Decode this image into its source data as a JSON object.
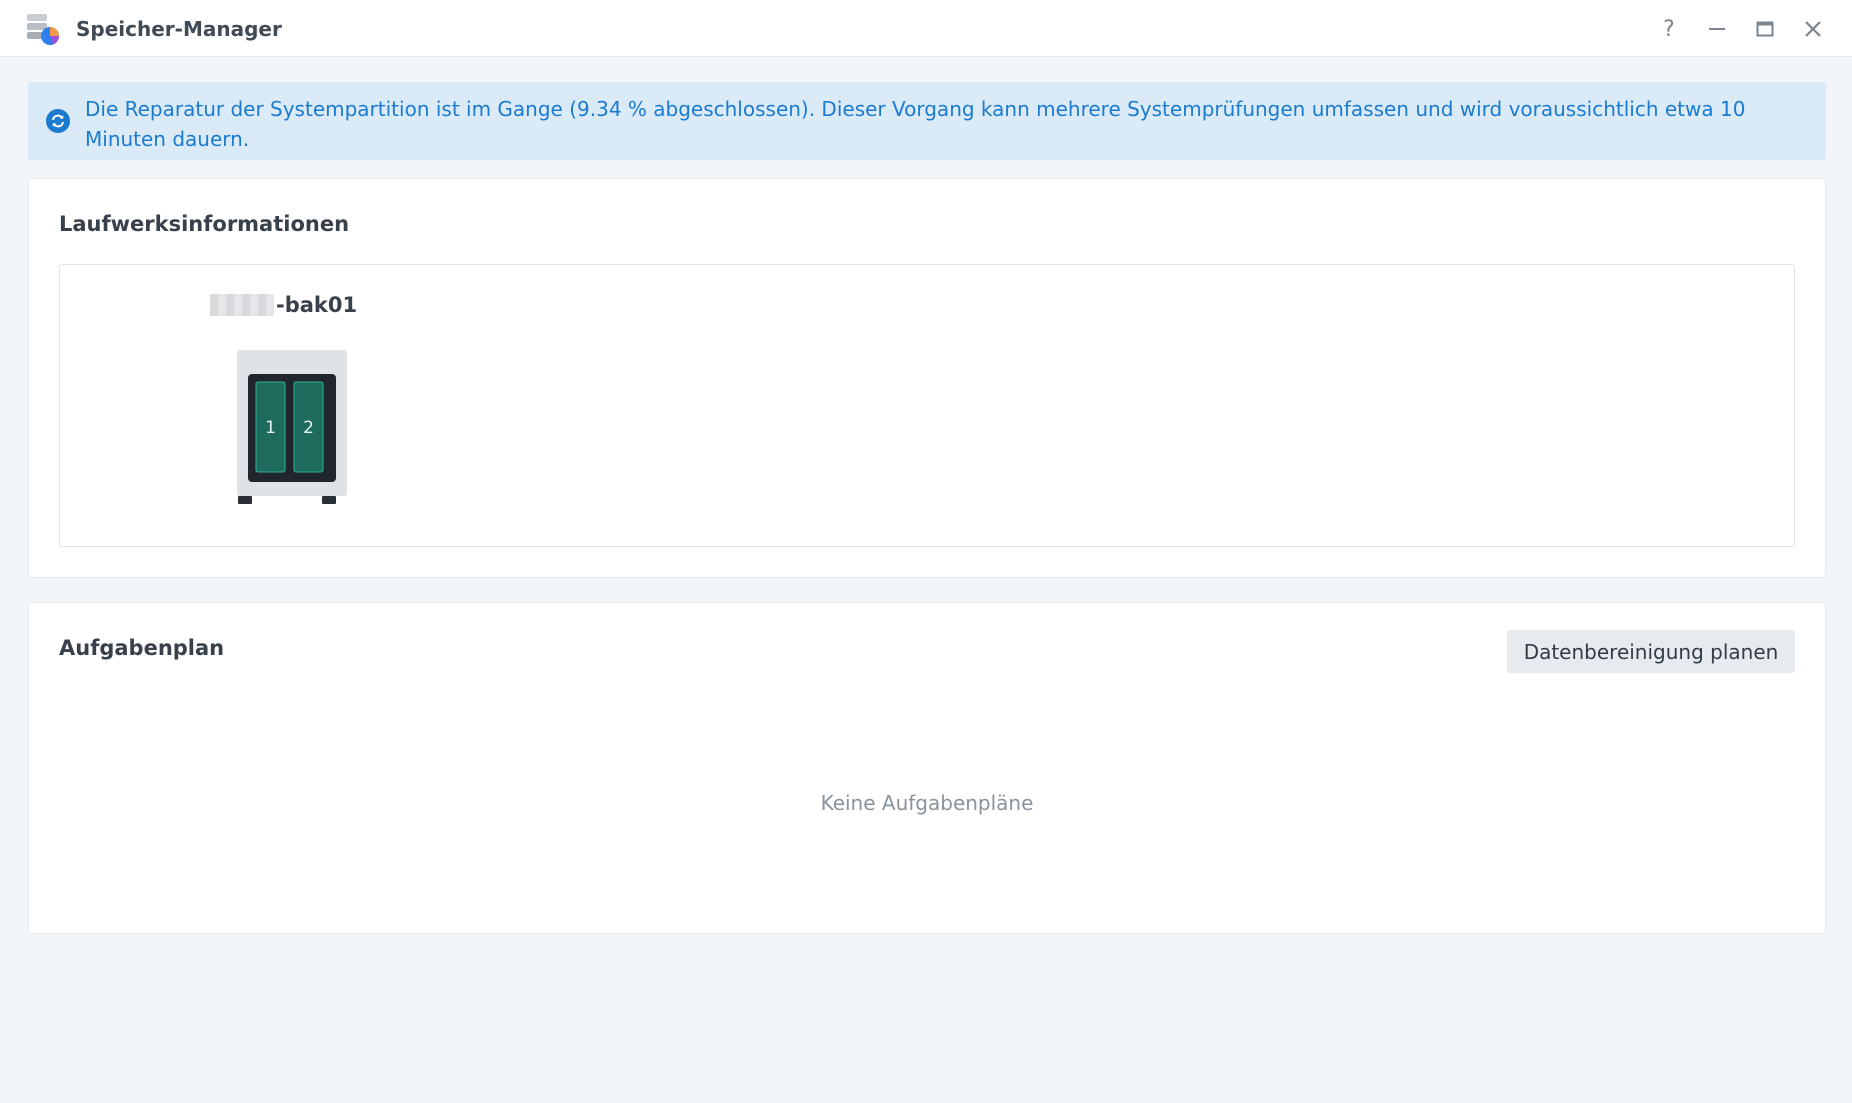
{
  "window": {
    "title": "Speicher-Manager",
    "controls": {
      "help": "?",
      "minimize_icon": "minimize-icon",
      "maximize_icon": "maximize-icon",
      "close_icon": "close-icon"
    }
  },
  "banner": {
    "icon": "refresh-icon",
    "text": "Die Reparatur der Systempartition ist im Gange (9.34 % abgeschlossen). Dieser Vorgang kann mehrere Systemprüfungen umfassen und wird voraussichtlich etwa 10 Minuten dauern.",
    "color": "#1a7bd0",
    "background": "#dbeaf7"
  },
  "drive_info": {
    "title": "Laufwerksinformationen",
    "device_name_suffix": "-bak01",
    "bays": [
      "1",
      "2"
    ],
    "bay_color": "#1e6b5e"
  },
  "task_plan": {
    "title": "Aufgabenplan",
    "button_label": "Datenbereinigung planen",
    "empty_text": "Keine Aufgabenpläne"
  }
}
